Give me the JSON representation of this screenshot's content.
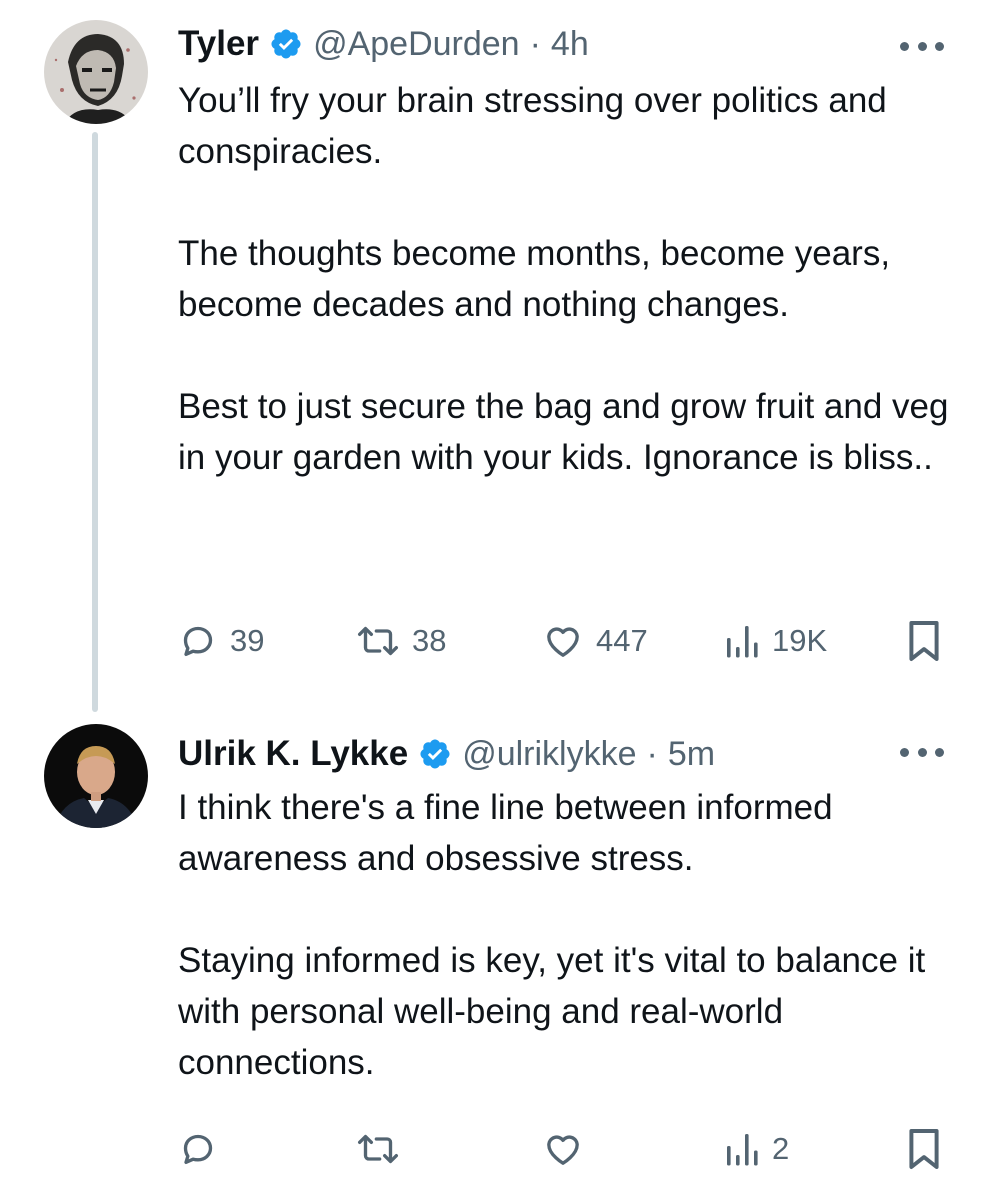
{
  "tweets": [
    {
      "author_name": "Tyler",
      "handle": "@ApeDurden",
      "separator": "·",
      "time": "4h",
      "paragraphs": [
        "You’ll fry your brain stressing over politics and conspiracies.",
        "The thoughts become months, become years, become decades and nothing changes.",
        "Best to just secure the bag and grow fruit and veg in your garden with your kids. Ignorance is bliss.."
      ],
      "stats": {
        "replies": "39",
        "retweets": "38",
        "likes": "447",
        "views": "19K"
      }
    },
    {
      "author_name": "Ulrik K. Lykke",
      "handle": "@ulriklykke",
      "separator": "·",
      "time": "5m",
      "paragraphs": [
        "I think there's a fine line between informed awareness and obsessive stress.",
        "Staying informed is key, yet it's vital to balance it with personal well-being and real-world connections."
      ],
      "stats": {
        "replies": "",
        "retweets": "",
        "likes": "",
        "views": "2"
      }
    }
  ],
  "icons": {
    "verified": "verified-badge-icon",
    "more": "more-options-icon",
    "reply": "reply-icon",
    "retweet": "retweet-icon",
    "like": "heart-icon",
    "views": "views-chart-icon",
    "bookmark": "bookmark-icon"
  },
  "colors": {
    "text": "#0f1419",
    "secondary": "#536471",
    "verified": "#1d9bf0",
    "thread_line": "#cfd9de"
  }
}
